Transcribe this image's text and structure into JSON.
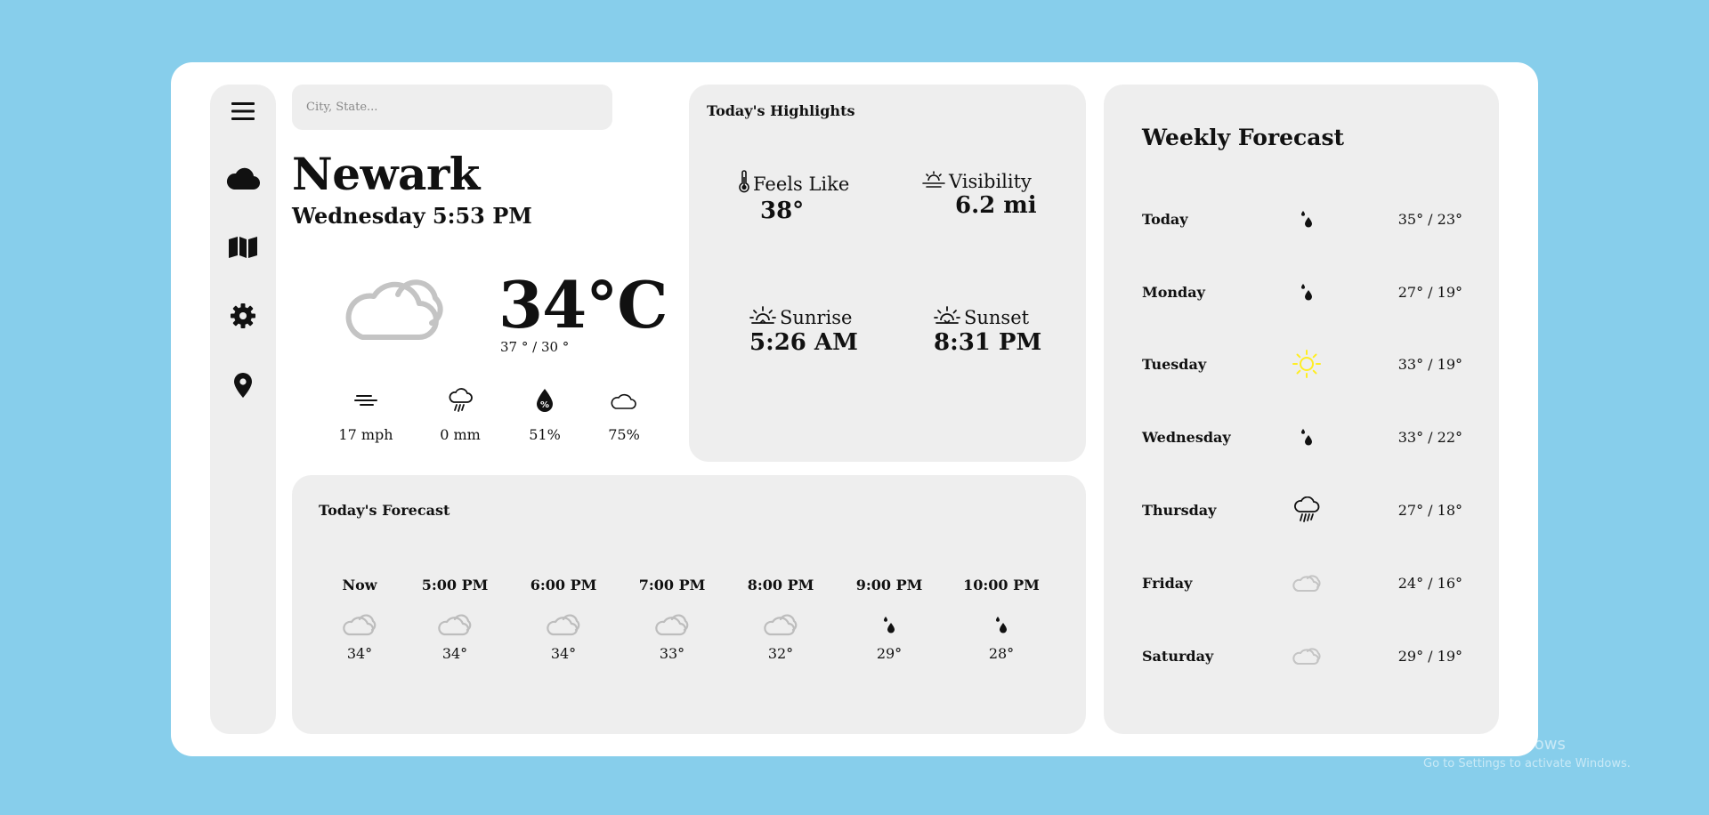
{
  "search": {
    "placeholder": "City, State..."
  },
  "current": {
    "city": "Newark",
    "datetime": "Wednesday 5:53 PM",
    "temperature": "34°C",
    "range": "37 ° / 30 °",
    "condition_icon": "cloud-icon"
  },
  "stats": [
    {
      "icon": "wind-icon",
      "value": "17 mph"
    },
    {
      "icon": "rain-icon",
      "value": "0 mm"
    },
    {
      "icon": "humidity-icon",
      "value": "51%"
    },
    {
      "icon": "cloud-icon",
      "value": "75%"
    }
  ],
  "highlights": {
    "title": "Today's Highlights",
    "feels_like": {
      "label": "Feels Like",
      "value": "38°",
      "icon": "thermometer-icon"
    },
    "visibility": {
      "label": "Visibility",
      "value": "6.2 mi",
      "icon": "haze-icon"
    },
    "sunrise": {
      "label": "Sunrise",
      "value": "5:26 AM",
      "icon": "sunrise-icon"
    },
    "sunset": {
      "label": "Sunset",
      "value": "8:31 PM",
      "icon": "sunset-icon"
    }
  },
  "today_forecast": {
    "title": "Today's Forecast",
    "hours": [
      {
        "time": "Now",
        "temp": "34°",
        "icon": "cloud-icon"
      },
      {
        "time": "5:00 PM",
        "temp": "34°",
        "icon": "cloud-icon"
      },
      {
        "time": "6:00 PM",
        "temp": "34°",
        "icon": "cloud-icon"
      },
      {
        "time": "7:00 PM",
        "temp": "33°",
        "icon": "cloud-icon"
      },
      {
        "time": "8:00 PM",
        "temp": "32°",
        "icon": "cloud-icon"
      },
      {
        "time": "9:00 PM",
        "temp": "29°",
        "icon": "drizzle-icon"
      },
      {
        "time": "10:00 PM",
        "temp": "28°",
        "icon": "drizzle-icon"
      }
    ]
  },
  "weekly": {
    "title": "Weekly Forecast",
    "days": [
      {
        "day": "Today",
        "range": "35° / 23°",
        "icon": "drizzle-icon"
      },
      {
        "day": "Monday",
        "range": "27° / 19°",
        "icon": "drizzle-icon"
      },
      {
        "day": "Tuesday",
        "range": "33° / 19°",
        "icon": "sun-icon"
      },
      {
        "day": "Wednesday",
        "range": "33° / 22°",
        "icon": "drizzle-icon"
      },
      {
        "day": "Thursday",
        "range": "27° / 18°",
        "icon": "rain-icon"
      },
      {
        "day": "Friday",
        "range": "24° / 16°",
        "icon": "cloud-icon"
      },
      {
        "day": "Saturday",
        "range": "29° / 19°",
        "icon": "cloud-icon"
      }
    ]
  },
  "watermark": {
    "line1": "Activate Windows",
    "line2": "Go to Settings to activate Windows."
  },
  "colors": {
    "background": "#87ceeb",
    "card": "#ffffff",
    "panel": "#eeeeee",
    "cloud_gray": "#c4c4c4",
    "sun_yellow": "#ffee22"
  }
}
